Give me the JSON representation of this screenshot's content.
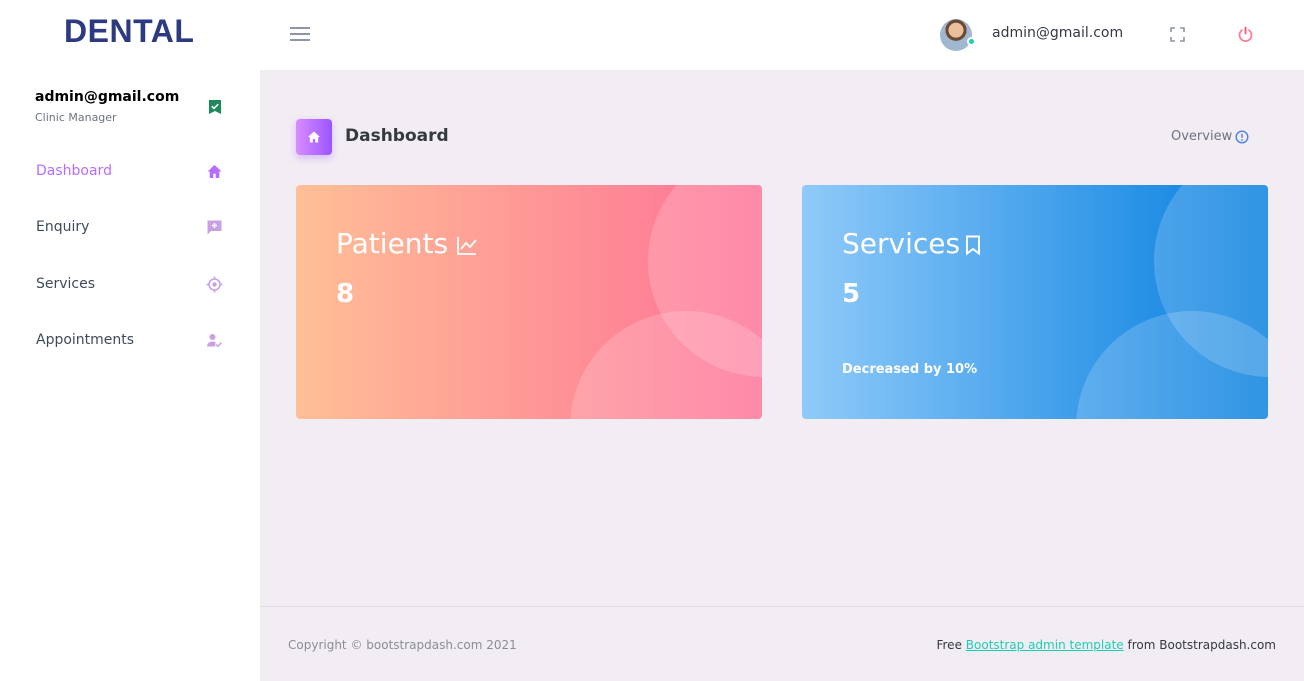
{
  "navbar": {
    "brand": "DENTAL",
    "user_email": "admin@gmail.com",
    "icons": [
      "menu-icon",
      "fullscreen-icon",
      "power-icon"
    ],
    "avatar_status_color": "#1bcfb4"
  },
  "sidebar": {
    "profile": {
      "email": "admin@gmail.com",
      "role": "Clinic Manager",
      "badge_icon": "check-badge-icon",
      "badge_color": "#1e8a5c"
    },
    "items": [
      {
        "label": "Dashboard",
        "icon": "home-icon",
        "active": true
      },
      {
        "label": "Enquiry",
        "icon": "message-plus-icon",
        "active": false
      },
      {
        "label": "Services",
        "icon": "crosshairs-icon",
        "active": false
      },
      {
        "label": "Appointments",
        "icon": "account-check-icon",
        "active": false
      }
    ],
    "active_color": "#b66dff"
  },
  "page_header": {
    "title": "Dashboard",
    "overview_label": "Overview",
    "icon": "home-icon"
  },
  "cards": [
    {
      "title": "Patients",
      "value": "8",
      "icon": "chart-line-icon",
      "gradient": [
        "#ffbf96",
        "#fe7096"
      ]
    },
    {
      "title": "Services",
      "value": "5",
      "note": "Decreased by 10%",
      "icon": "bookmark-icon",
      "gradient": [
        "#90caf9",
        "#047edf"
      ]
    }
  ],
  "footer": {
    "copyright": "Copyright © bootstrapdash.com 2021",
    "prefix": "Free",
    "link": "Bootstrap admin template",
    "suffix": "from Bootstrapdash.com"
  }
}
